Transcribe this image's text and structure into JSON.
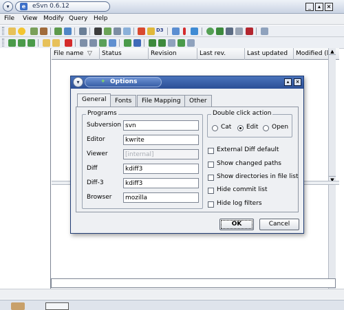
{
  "window": {
    "title": "eSvn 0.6.12",
    "menu": [
      "File",
      "View",
      "Modify",
      "Query",
      "Help"
    ]
  },
  "columns": [
    "File name",
    "Status",
    "Revision",
    "Last rev.",
    "Last updated",
    "Modified (l"
  ],
  "toolbar": {
    "diff3_label": "D3"
  },
  "dialog": {
    "title": "Options",
    "tabs": [
      "General",
      "Fonts",
      "File Mapping",
      "Other"
    ],
    "programs_group_title": "Programs",
    "programs": [
      {
        "label": "Subversion",
        "value": "svn"
      },
      {
        "label": "Editor",
        "value": "kwrite"
      },
      {
        "label": "Viewer",
        "value": "[internal]"
      },
      {
        "label": "Diff",
        "value": "kdiff3"
      },
      {
        "label": "Diff-3",
        "value": "kdiff3"
      },
      {
        "label": "Browser",
        "value": "mozilla"
      }
    ],
    "double_click_group_title": "Double click action",
    "double_click_options": [
      "Cat",
      "Edit",
      "Open"
    ],
    "double_click_selected": "Edit",
    "checkboxes": [
      "External Diff default",
      "Show changed paths",
      "Show directories in file list",
      "Hide commit list",
      "Hide log filters"
    ],
    "ok_label": "OK",
    "cancel_label": "Cancel"
  }
}
